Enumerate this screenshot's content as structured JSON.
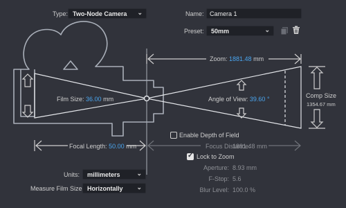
{
  "type": {
    "label": "Type:",
    "value": "Two-Node Camera"
  },
  "name": {
    "label": "Name:",
    "value": "Camera 1"
  },
  "preset": {
    "label": "Preset:",
    "value": "50mm"
  },
  "zoom": {
    "label": "Zoom:",
    "value": "1881.48",
    "unit": "mm"
  },
  "film_size": {
    "label": "Film Size:",
    "value": "36.00",
    "unit": "mm"
  },
  "angle_of_view": {
    "label": "Angle of View:",
    "value": "39.60",
    "unit": "°"
  },
  "comp_size": {
    "label": "Comp Size",
    "value": "1354.67 mm"
  },
  "focal_length": {
    "label": "Focal Length:",
    "value": "50.00",
    "unit": "mm"
  },
  "depth_of_field": {
    "label": "Enable Depth of Field",
    "checked": false
  },
  "focus_distance": {
    "label": "Focus Distance:",
    "value": "1881.48 mm"
  },
  "lock_to_zoom": {
    "label": "Lock to Zoom",
    "checked": true
  },
  "aperture": {
    "label": "Aperture:",
    "value": "8.93 mm"
  },
  "fstop": {
    "label": "F-Stop:",
    "value": "5.6"
  },
  "blur_level": {
    "label": "Blur Level:",
    "value": "100.0 %"
  },
  "units": {
    "label": "Units:",
    "value": "millimeters"
  },
  "measure_film_size": {
    "label": "Measure Film Size:",
    "value": "Horizontally"
  },
  "icons": [
    "chevron-down-icon",
    "copy-preset-icon",
    "trash-icon",
    "camera-diagram-icon"
  ]
}
